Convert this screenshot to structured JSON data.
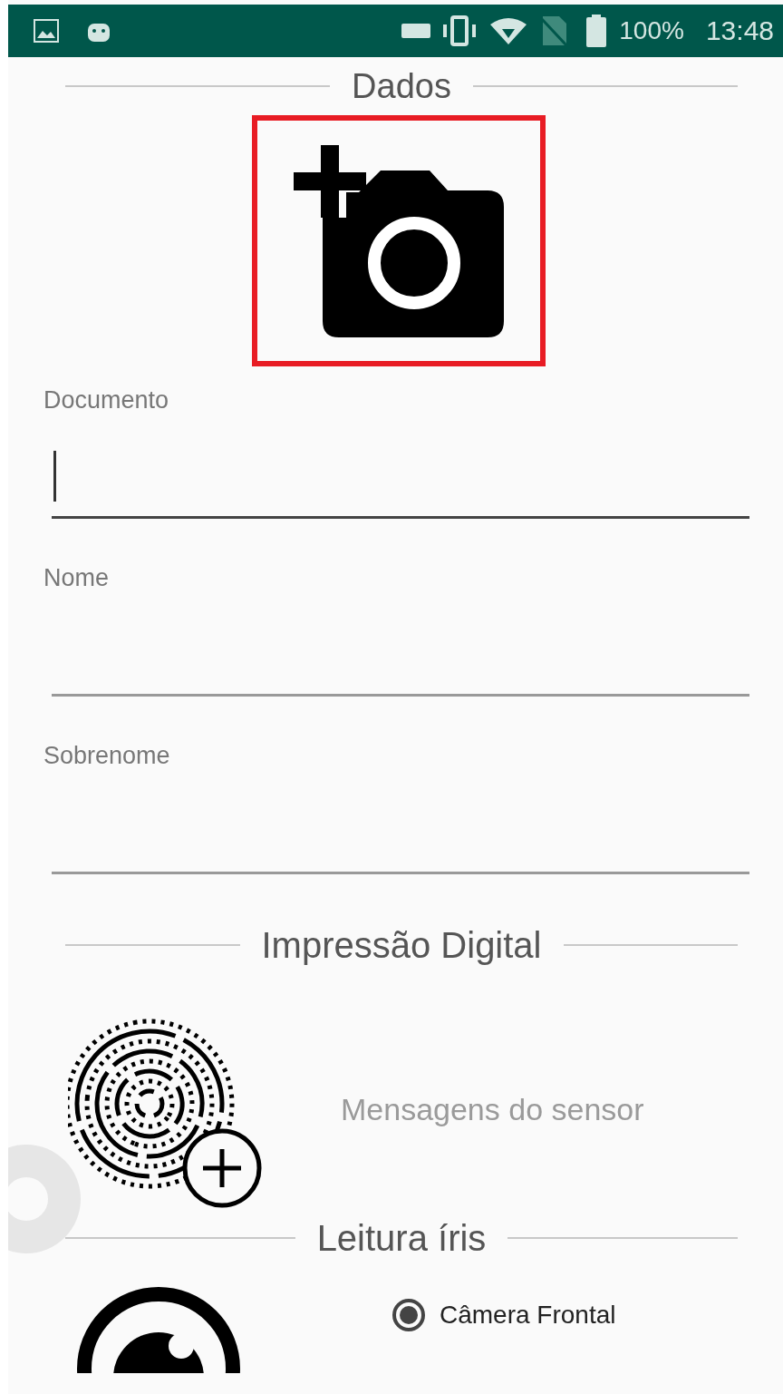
{
  "status_bar": {
    "battery": "100%",
    "time": "13:48"
  },
  "sections": [
    {
      "title": "Dados"
    },
    {
      "title": "Impressão Digital"
    },
    {
      "title": "Leitura íris"
    }
  ],
  "photo_button": {
    "highlighted": true
  },
  "fields": [
    {
      "label": "Documento",
      "focused": true
    },
    {
      "label": "Nome",
      "focused": false
    },
    {
      "label": "Sobrenome",
      "focused": false
    }
  ],
  "fingerprint": {
    "message": "Mensagens do sensor"
  },
  "iris": {
    "options": [
      {
        "label": "Câmera Frontal",
        "selected": true
      }
    ]
  }
}
